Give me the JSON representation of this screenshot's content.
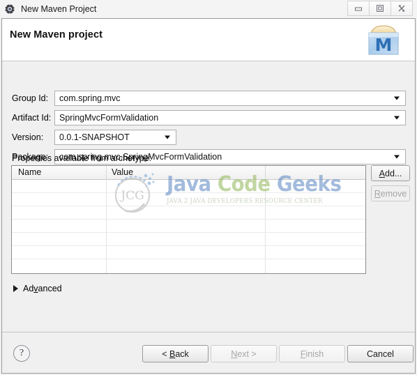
{
  "titlebar": {
    "icon": "eclipse-wizard-gear-icon",
    "title": "New Maven Project",
    "minimize_label": "minimize-icon",
    "maximize_label": "restore-icon",
    "close_label": "close-icon"
  },
  "header": {
    "title": "New Maven project",
    "logo": "maven-logo-icon",
    "logo_letter": "M"
  },
  "form": {
    "fields": [
      {
        "label": "Group Id:",
        "value": "com.spring.mvc",
        "combo": true
      },
      {
        "label": "Artifact Id:",
        "value": "SpringMvcFormValidation",
        "combo": true
      },
      {
        "label": "Version:",
        "value": "0.0.1-SNAPSHOT",
        "combo": true
      },
      {
        "label": "Package:",
        "value": "com.spring.mvc.SpringMvcFormValidation",
        "combo": true
      }
    ]
  },
  "properties": {
    "label": "Properties available from archetype:",
    "columns": [
      "Name",
      "Value"
    ],
    "rows": [],
    "empty_row_count": 7,
    "buttons": [
      {
        "label": "Add...",
        "accel": "A",
        "enabled": true
      },
      {
        "label": "Remove",
        "accel": "R",
        "enabled": false
      }
    ]
  },
  "watermark": {
    "logo": "jcg-circle-logo",
    "logo_text": "JCG",
    "title_part1": "Java ",
    "title_part2": "Code ",
    "title_part3": "Geeks",
    "subtitle": "JAVA 2 JAVA DEVELOPERS RESOURCE CENTER",
    "color_blue": "#6b93c8",
    "color_green": "#9cbd6a"
  },
  "advanced": {
    "label": "Advanced",
    "expanded": false
  },
  "footer": {
    "help_label": "?",
    "buttons": [
      {
        "label": "< Back",
        "accel": "B",
        "enabled": true
      },
      {
        "label": "Next >",
        "accel": "N",
        "enabled": false
      },
      {
        "label": "Finish",
        "accel": "F",
        "enabled": false
      },
      {
        "label": "Cancel",
        "accel": "",
        "enabled": true
      }
    ]
  }
}
